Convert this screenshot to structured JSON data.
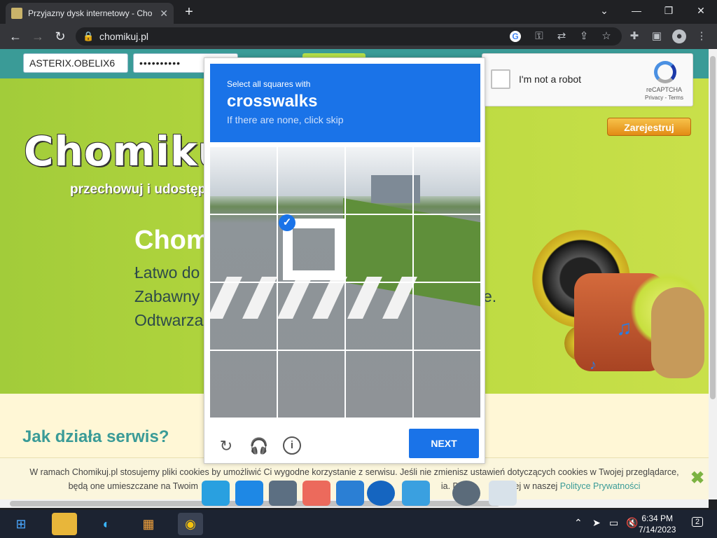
{
  "browser": {
    "tab_title": "Przyjazny dysk internetowy - Cho",
    "url": "chomikuj.pl",
    "window_controls": [
      "chevron-down",
      "minimize",
      "restore",
      "close"
    ]
  },
  "site": {
    "login_value": "ASTERIX.OBELIX6",
    "password_mask": "••••••••••",
    "brand": "Chomikuj.",
    "tagline": "przechowuj i udostępni",
    "heading": "Chom",
    "line1": "Łatwo do",
    "line2": "Zabawny",
    "line2_end": "e.",
    "line3": "Odtwarza",
    "register_label": "Zarejestruj",
    "how_heading": "Jak działa serwis?"
  },
  "cookie": {
    "line1": "W ramach Chomikuj.pl stosujemy pliki cookies by umożliwić Ci wygodne korzystanie z serwisu. Jeśli nie zmienisz ustawień dotyczących cookies w Twojej przeglądarce,",
    "line2_start": "będą one umieszczane na Twoim ",
    "line2_mid": "ia. Dowie",
    "line2_mid2": "cej w naszej ",
    "policy_link": "Polityce Prywatności"
  },
  "recaptcha": {
    "label": "I'm not a robot",
    "brand": "reCAPTCHA",
    "terms": "Privacy - Terms"
  },
  "challenge": {
    "instruction": "Select all squares with",
    "target": "crosswalks",
    "hint": "If there are none, click skip",
    "next_label": "NEXT"
  },
  "taskbar": {
    "time": "6:34 PM",
    "date": "7/14/2023",
    "notifications": "2"
  }
}
